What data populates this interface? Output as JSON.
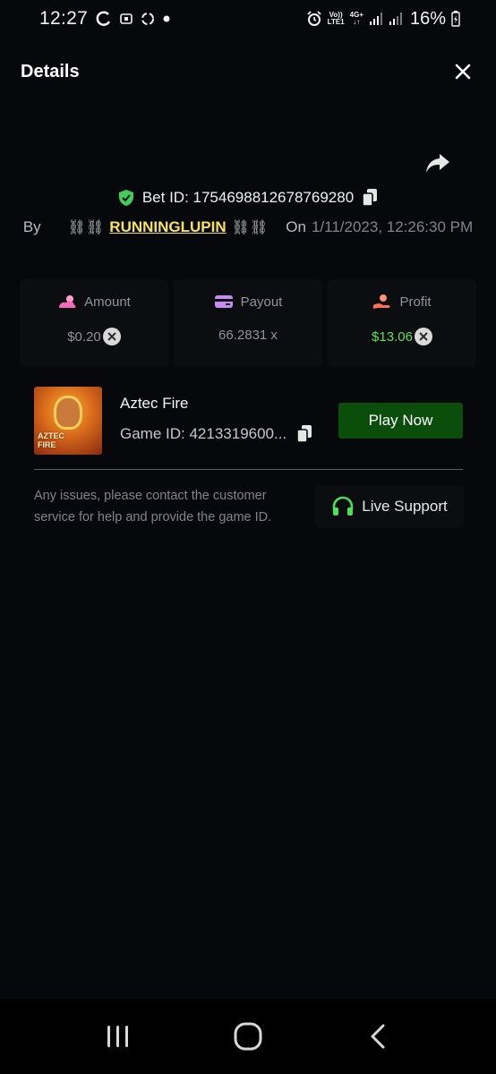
{
  "status_bar": {
    "time": "12:27",
    "net_label_top": "Vo))",
    "net_label_bottom": "LTE1",
    "net_type": "4G+",
    "battery": "16%"
  },
  "header": {
    "title": "Details"
  },
  "bet": {
    "label": "Bet ID: 1754698812678769280",
    "by_label": "By",
    "user_prefix": "⛓⛓",
    "username": "RUNNINGLUPIN",
    "user_suffix": "⛓⛓",
    "on_label": "On",
    "date": "1/11/2023, 12:26:30 PM"
  },
  "stats": {
    "amount": {
      "label": "Amount",
      "value": "$0.20"
    },
    "payout": {
      "label": "Payout",
      "value": "66.2831 x"
    },
    "profit": {
      "label": "Profit",
      "value": "$13.06"
    }
  },
  "game": {
    "thumb_label_1": "AZTEC",
    "thumb_label_2": "FIRE",
    "name": "Aztec Fire",
    "id_label": "Game ID: 4213319600...",
    "play_label": "Play Now"
  },
  "support": {
    "help_text": "Any issues, please contact the customer service for help and provide the game ID.",
    "button_label": "Live Support"
  },
  "colors": {
    "accent_green": "#0b4d0b",
    "profit_green": "#5ce05c",
    "username_yellow": "#f7e35a",
    "background": "#07080b"
  },
  "icons": [
    "shield-check-icon",
    "copy-icon",
    "share-icon",
    "close-icon",
    "sun-cloud-icon",
    "card-icon",
    "hand-person-icon",
    "coin-x-icon",
    "headphones-icon",
    "recents-icon",
    "home-icon",
    "back-icon"
  ]
}
